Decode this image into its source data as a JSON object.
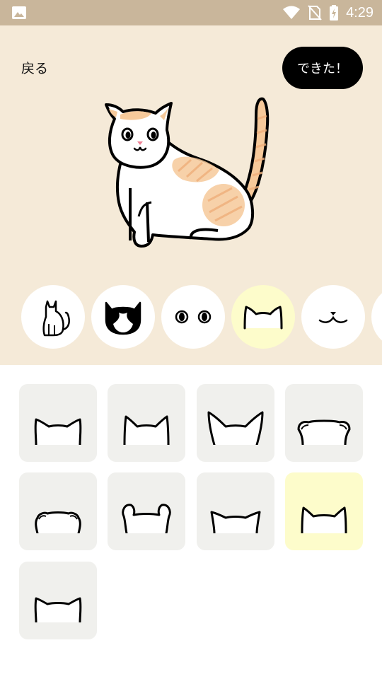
{
  "status_bar": {
    "time": "4:29",
    "icons": [
      "gallery-icon",
      "wifi-icon",
      "no-sim-icon",
      "battery-charging-icon"
    ]
  },
  "header": {
    "back_label": "戻る",
    "done_label": "できた！"
  },
  "categories": [
    {
      "icon": "cat-body-icon",
      "selected": false
    },
    {
      "icon": "cat-pattern-icon",
      "selected": false
    },
    {
      "icon": "cat-eyes-icon",
      "selected": false
    },
    {
      "icon": "cat-ears-icon",
      "selected": true
    },
    {
      "icon": "cat-mouth-icon",
      "selected": false
    },
    {
      "icon": "category-more-icon",
      "selected": false
    }
  ],
  "ear_options": [
    {
      "icon": "ear-style-1-icon",
      "selected": false
    },
    {
      "icon": "ear-style-2-icon",
      "selected": false
    },
    {
      "icon": "ear-style-3-icon",
      "selected": false
    },
    {
      "icon": "ear-style-4-icon",
      "selected": false
    },
    {
      "icon": "ear-style-5-icon",
      "selected": false
    },
    {
      "icon": "ear-style-6-icon",
      "selected": false
    },
    {
      "icon": "ear-style-7-icon",
      "selected": false
    },
    {
      "icon": "ear-style-8-icon",
      "selected": true
    },
    {
      "icon": "ear-style-9-icon",
      "selected": false
    }
  ],
  "colors": {
    "status_bar": "#c9b69b",
    "editor_bg": "#f5ead8",
    "selected": "#fdfccb",
    "tile_bg": "#f0f0ed",
    "cat_tabby": "#f6c99a"
  }
}
